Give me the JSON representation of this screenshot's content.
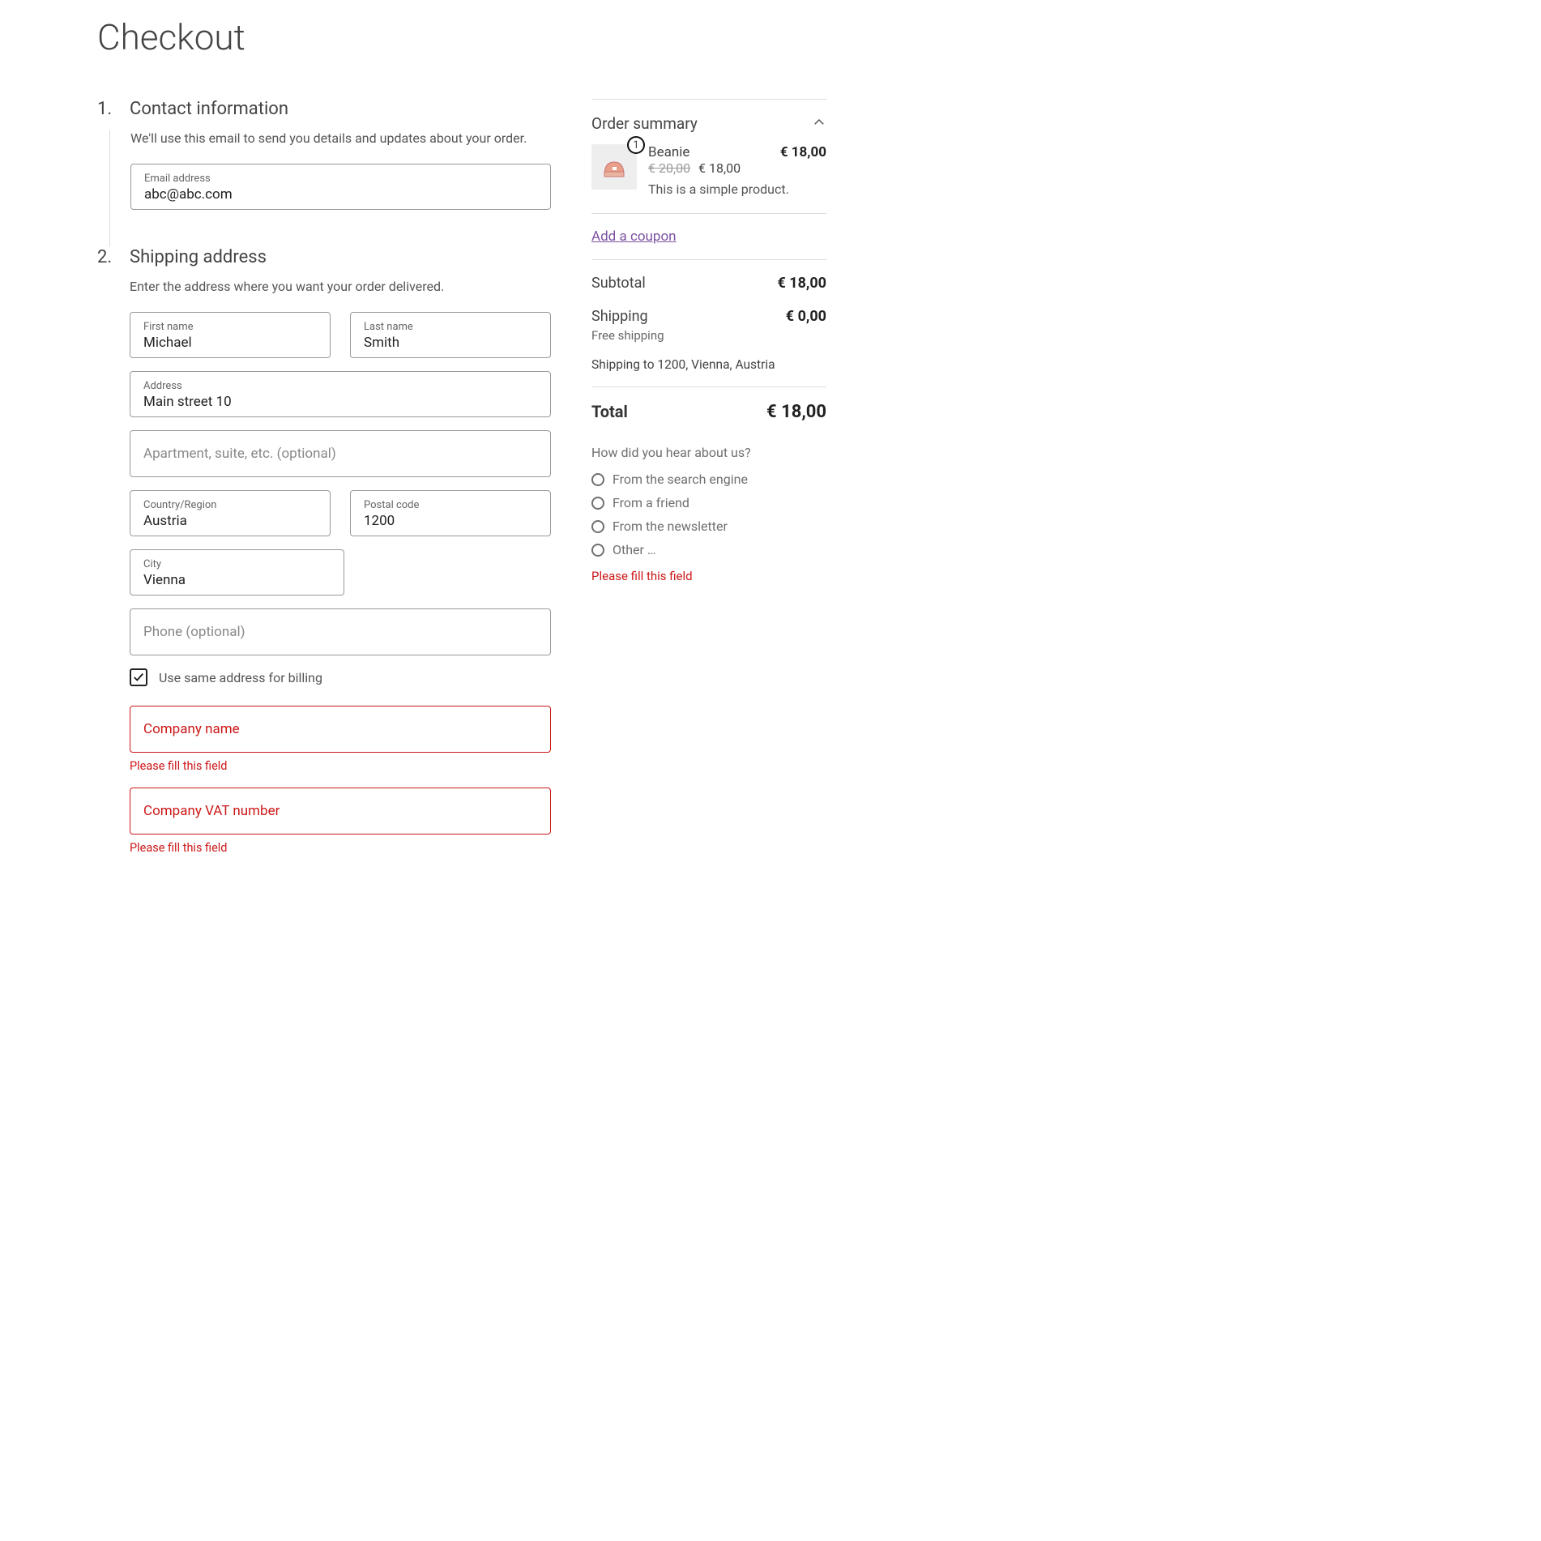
{
  "page_title": "Checkout",
  "contact": {
    "num": "1.",
    "title": "Contact information",
    "desc": "We'll use this email to send you details and updates about your order.",
    "email_label": "Email address",
    "email_value": "abc@abc.com"
  },
  "shipping": {
    "num": "2.",
    "title": "Shipping address",
    "desc": "Enter the address where you want your order delivered.",
    "first_name_label": "First name",
    "first_name_value": "Michael",
    "last_name_label": "Last name",
    "last_name_value": "Smith",
    "address_label": "Address",
    "address_value": "Main street 10",
    "apt_placeholder": "Apartment, suite, etc. (optional)",
    "country_label": "Country/Region",
    "country_value": "Austria",
    "postal_label": "Postal code",
    "postal_value": "1200",
    "city_label": "City",
    "city_value": "Vienna",
    "phone_placeholder": "Phone (optional)",
    "same_billing_label": "Use same address for billing",
    "company_placeholder": "Company name",
    "company_err": "Please fill this field",
    "vat_placeholder": "Company VAT number",
    "vat_err": "Please fill this field"
  },
  "summary": {
    "title": "Order summary",
    "product": {
      "qty": "1",
      "name": "Beanie",
      "price": "€ 18,00",
      "orig": "€ 20,00",
      "curr": "€ 18,00",
      "desc": "This is a simple product."
    },
    "coupon": "Add a coupon",
    "subtotal_label": "Subtotal",
    "subtotal_val": "€ 18,00",
    "shipping_label": "Shipping",
    "shipping_val": "€ 0,00",
    "shipping_note": "Free shipping",
    "ship_to": "Shipping to 1200, Vienna, Austria",
    "total_label": "Total",
    "total_val": "€ 18,00"
  },
  "survey": {
    "question": "How did you hear about us?",
    "opt1": "From the search engine",
    "opt2": "From a friend",
    "opt3": "From the newsletter",
    "opt4": "Other …",
    "err": "Please fill this field"
  }
}
